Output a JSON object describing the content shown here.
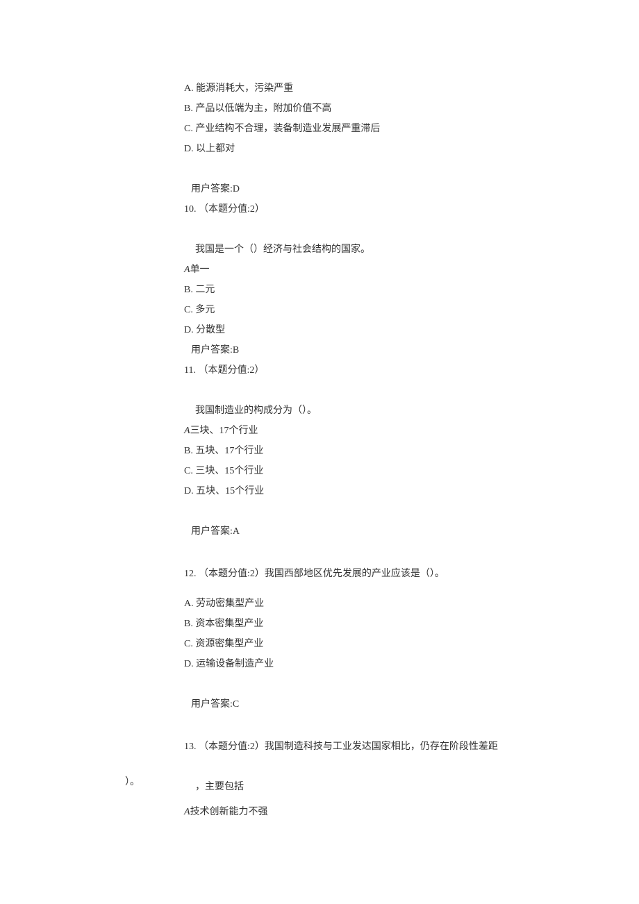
{
  "q9": {
    "options": {
      "a": "A.  能源消耗大，污染严重",
      "b": "B.  产品以低端为主，附加价值不高",
      "c": "C.  产业结构不合理，装备制造业发展严重滞后",
      "d": "D.  以上都对"
    },
    "answer": "用户答案:D"
  },
  "q10": {
    "header": "10.  （本题分值:2）",
    "stem": "我国是一个（）经济与社会结构的国家。",
    "options": {
      "a_prefix": "A",
      "a_text": "单一",
      "b": "B.  二元",
      "c": "C.  多元",
      "d": "D.  分散型"
    },
    "answer": "用户答案:B"
  },
  "q11": {
    "header": "11.    （本题分值:2）",
    "stem": "我国制造业的构成分为（）。",
    "options": {
      "a_prefix": "A",
      "a_text": "三块、17个行业",
      "b": "B.  五块、17个行业",
      "c": "C.  三块、15个行业",
      "d": "D.  五块、15个行业"
    },
    "answer": "用户答案:A"
  },
  "q12": {
    "header": "12.    （本题分值:2）我国西部地区优先发展的产业应该是（）。",
    "options": {
      "a": "A.  劳动密集型产业",
      "b": "B.  资本密集型产业",
      "c": "C.  资源密集型产业",
      "d": "D.  运输设备制造产业"
    },
    "answer": "用户答案:C"
  },
  "q13": {
    "header": "13.  （本题分值:2）我国制造科技与工业发达国家相比，仍存在阶段性差距",
    "stem_part2": "，主要包括",
    "stem_outdent": "）。",
    "options": {
      "a_prefix": "A",
      "a_text": "技术创新能力不强"
    }
  }
}
